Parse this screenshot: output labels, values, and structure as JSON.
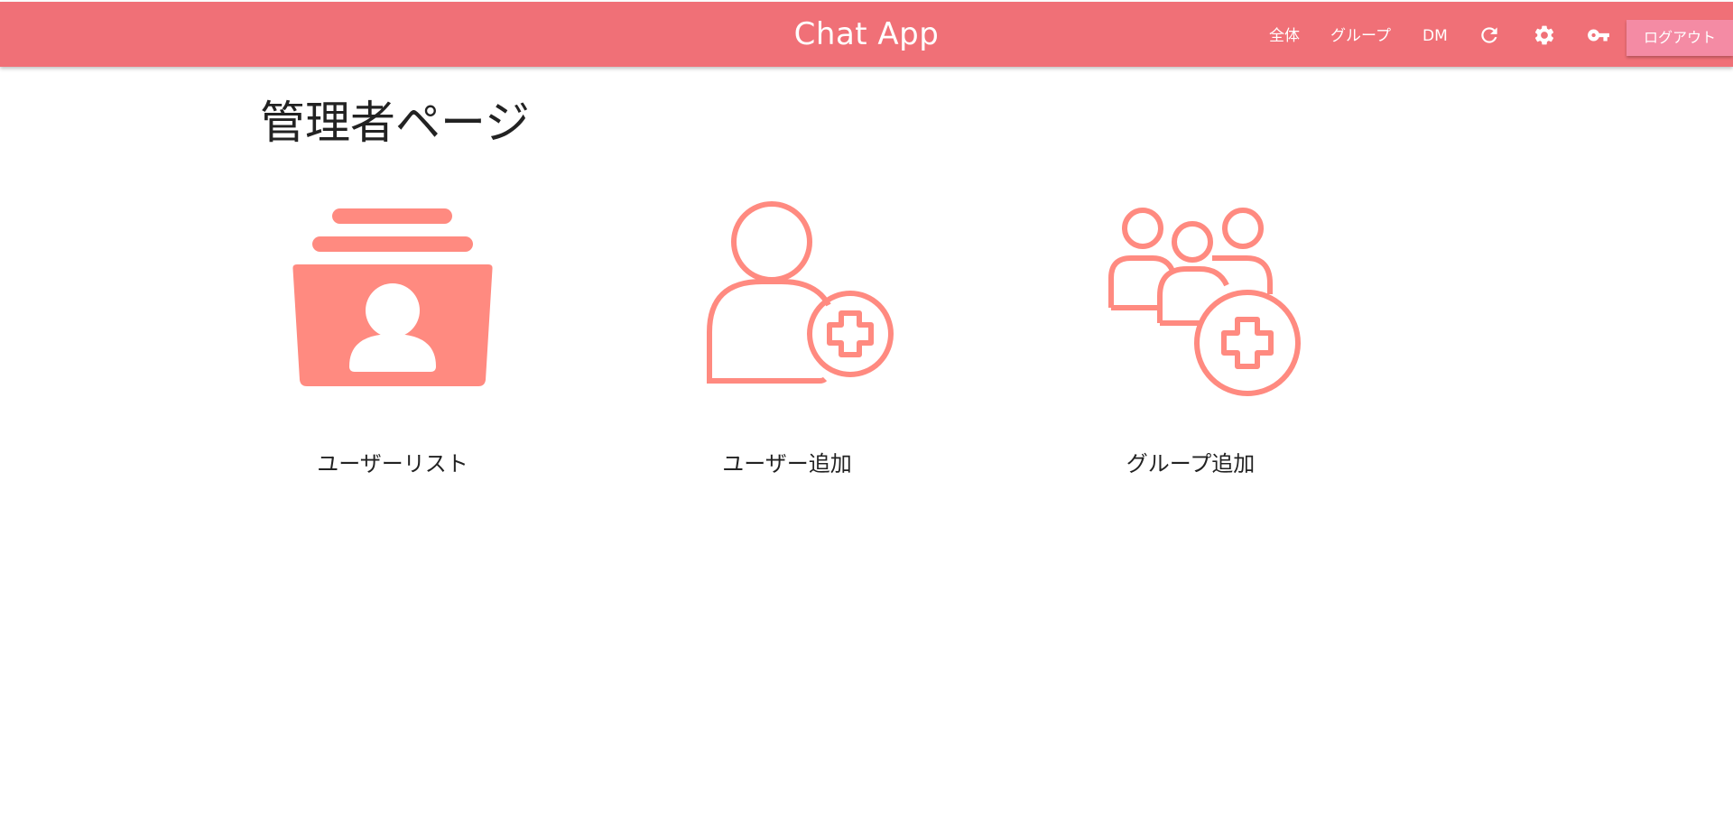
{
  "header": {
    "app_title": "Chat App",
    "nav": [
      {
        "label": "全体"
      },
      {
        "label": "グループ"
      },
      {
        "label": "DM"
      }
    ],
    "icons": [
      "refresh-icon",
      "gear-icon",
      "key-icon"
    ],
    "logout_label": "ログアウト"
  },
  "main": {
    "page_title": "管理者ページ",
    "cards": [
      {
        "label": "ユーザーリスト",
        "icon": "user-list-icon"
      },
      {
        "label": "ユーザー追加",
        "icon": "add-user-icon"
      },
      {
        "label": "グループ追加",
        "icon": "add-group-icon"
      }
    ]
  },
  "colors": {
    "header_bg": "#f07077",
    "logout_bg": "#f48ba4",
    "icon_accent": "#ff8a80",
    "text": "#222222"
  }
}
